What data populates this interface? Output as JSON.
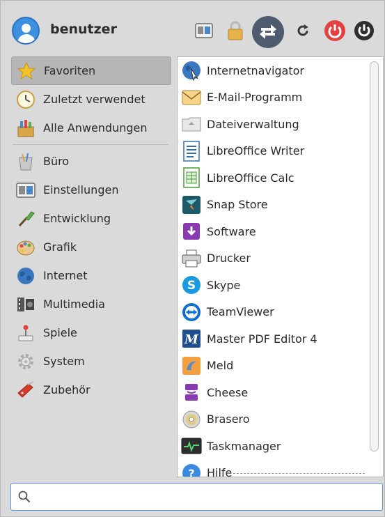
{
  "header": {
    "username": "benutzer"
  },
  "categories": [
    {
      "label": "Favoriten",
      "icon": "star-icon"
    },
    {
      "label": "Zuletzt verwendet",
      "icon": "clock-icon"
    },
    {
      "label": "Alle Anwendungen",
      "icon": "all-applications-icon"
    },
    {
      "label": "Büro",
      "icon": "office-icon"
    },
    {
      "label": "Einstellungen",
      "icon": "settings-icon"
    },
    {
      "label": "Entwicklung",
      "icon": "development-icon"
    },
    {
      "label": "Grafik",
      "icon": "graphics-icon"
    },
    {
      "label": "Internet",
      "icon": "globe-icon"
    },
    {
      "label": "Multimedia",
      "icon": "multimedia-icon"
    },
    {
      "label": "Spiele",
      "icon": "joystick-icon"
    },
    {
      "label": "System",
      "icon": "system-gear-icon"
    },
    {
      "label": "Zubehör",
      "icon": "accessories-icon"
    }
  ],
  "apps": [
    {
      "label": "Internetnavigator",
      "icon": "web-browser-icon"
    },
    {
      "label": "E-Mail-Programm",
      "icon": "mail-icon"
    },
    {
      "label": "Dateiverwaltung",
      "icon": "file-manager-icon"
    },
    {
      "label": "LibreOffice Writer",
      "icon": "libreoffice-writer-icon"
    },
    {
      "label": "LibreOffice Calc",
      "icon": "libreoffice-calc-icon"
    },
    {
      "label": "Snap Store",
      "icon": "snap-store-icon"
    },
    {
      "label": "Software",
      "icon": "software-icon"
    },
    {
      "label": "Drucker",
      "icon": "printer-icon"
    },
    {
      "label": "Skype",
      "icon": "skype-icon"
    },
    {
      "label": "TeamViewer",
      "icon": "teamviewer-icon"
    },
    {
      "label": "Master PDF Editor 4",
      "icon": "master-pdf-icon"
    },
    {
      "label": "Meld",
      "icon": "meld-icon"
    },
    {
      "label": "Cheese",
      "icon": "cheese-icon"
    },
    {
      "label": "Brasero",
      "icon": "brasero-icon"
    },
    {
      "label": "Taskmanager",
      "icon": "task-manager-icon"
    },
    {
      "label": "Hilfe",
      "icon": "help-icon"
    }
  ],
  "search": {
    "value": "",
    "placeholder": ""
  },
  "colors": {
    "accent": "#3d8fe0",
    "selected_bg": "#b6b6b6",
    "logout_red": "#e34040"
  }
}
